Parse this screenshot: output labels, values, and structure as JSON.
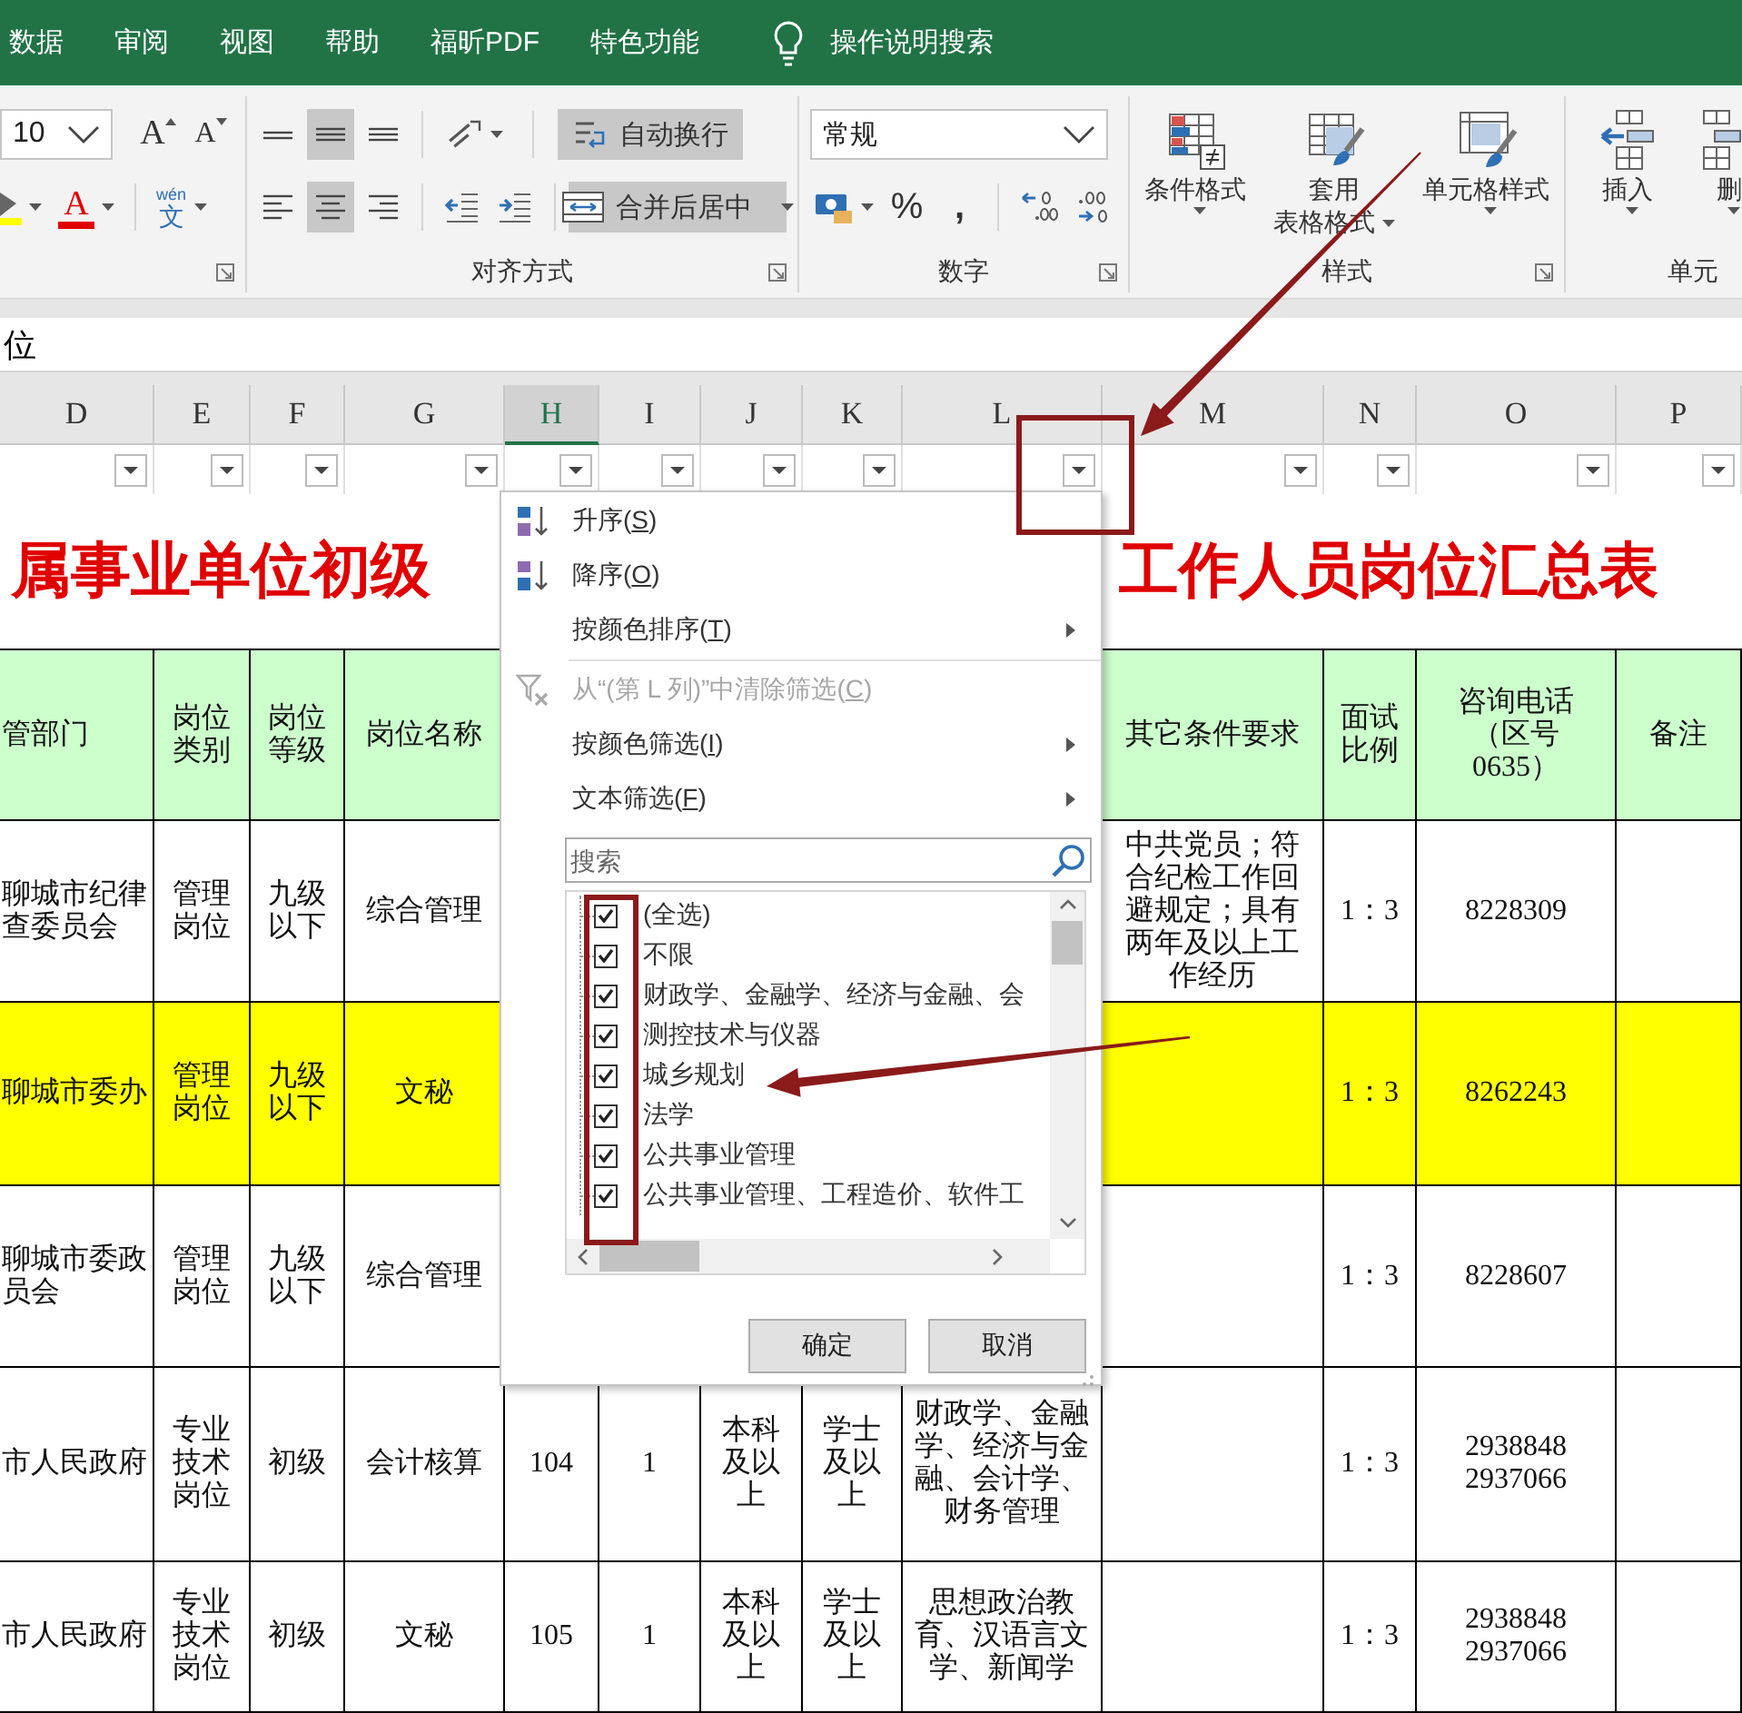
{
  "ribbon": {
    "tabs": [
      {
        "label": "数据",
        "selected": false
      },
      {
        "label": "审阅",
        "selected": false
      },
      {
        "label": "视图",
        "selected": false
      },
      {
        "label": "帮助",
        "selected": false
      },
      {
        "label": "福昕PDF",
        "selected": false
      },
      {
        "label": "特色功能",
        "selected": false
      }
    ],
    "tell_me": "操作说明搜索",
    "font": {
      "size": "10",
      "grow": "A",
      "shrink": "A",
      "fill_color": {
        "color": "#ffff00"
      },
      "font_color": {
        "glyph": "A",
        "color": "#e00000"
      },
      "phonetic": {
        "top": "wén",
        "glyph": "文"
      }
    },
    "alignment": {
      "label": "对齐方式",
      "vertical": [
        {
          "kind": "top",
          "selected": false
        },
        {
          "kind": "middle",
          "selected": true
        },
        {
          "kind": "bottom",
          "selected": false
        }
      ],
      "horizontal": [
        {
          "kind": "left",
          "selected": false
        },
        {
          "kind": "center",
          "selected": true
        },
        {
          "kind": "right",
          "selected": false
        }
      ],
      "wrap_text": {
        "label": "自动换行",
        "selected": true
      },
      "merge": {
        "label": "合并后居中",
        "selected": true
      }
    },
    "number": {
      "label": "数字",
      "format": "常规",
      "percent": "%",
      "comma": ","
    },
    "styles": {
      "label": "样式",
      "buttons": [
        {
          "kind": "conditional",
          "lines": [
            "条件格式"
          ]
        },
        {
          "kind": "table",
          "lines": [
            "套用",
            "表格格式"
          ]
        },
        {
          "kind": "cell",
          "lines": [
            "单元格样式"
          ]
        }
      ]
    },
    "cells": {
      "label": "单元",
      "buttons": [
        {
          "kind": "insert",
          "label": "插入"
        },
        {
          "kind": "delete",
          "label": "删"
        }
      ]
    }
  },
  "sheet": {
    "formula_bar": {
      "value": "位"
    },
    "columns": [
      {
        "letter": "D",
        "selected": false
      },
      {
        "letter": "E",
        "selected": false
      },
      {
        "letter": "F",
        "selected": false
      },
      {
        "letter": "G",
        "selected": false
      },
      {
        "letter": "H",
        "selected": true
      },
      {
        "letter": "I",
        "selected": false
      },
      {
        "letter": "J",
        "selected": false
      },
      {
        "letter": "K",
        "selected": false
      },
      {
        "letter": "L",
        "selected": false
      },
      {
        "letter": "M",
        "selected": false
      },
      {
        "letter": "N",
        "selected": false
      },
      {
        "letter": "O",
        "selected": false
      },
      {
        "letter": "P",
        "selected": false
      }
    ],
    "title": {
      "left": "属事业单位初级",
      "right": "工作人员岗位汇总表"
    },
    "header": {
      "D": "管部门",
      "E": "岗位类别",
      "F": "岗位等级",
      "G": "岗位名称",
      "M": "其它条件要求",
      "N": "面试比例",
      "O": "咨询电话（区号0635）",
      "P": "备注"
    },
    "rows": [
      {
        "highlighted": false,
        "cells": {
          "D": "聊城市纪律查委员会",
          "E": "管理岗位",
          "F": "九级以下",
          "G": "综合管理",
          "M": "中共党员；符合纪检工作回避规定；具有两年及以上工作经历",
          "N": "1：3",
          "O": "8228309"
        }
      },
      {
        "highlighted": true,
        "cells": {
          "D": "聊城市委办",
          "E": "管理岗位",
          "F": "九级以下",
          "G": "文秘",
          "N": "1：3",
          "O": "8262243"
        }
      },
      {
        "highlighted": false,
        "cells": {
          "D": "聊城市委政员会",
          "E": "管理岗位",
          "F": "九级以下",
          "G": "综合管理",
          "N": "1：3",
          "O": "8228607"
        }
      },
      {
        "highlighted": false,
        "cells": {
          "D": "市人民政府",
          "E": "专业技术岗位",
          "F": "初级",
          "G": "会计核算",
          "H": "104",
          "I": "1",
          "J": "本科及以上",
          "K": "学士及以上",
          "L": "财政学、金融学、经济与金融、会计学、财务管理",
          "N": "1：3",
          "O": "2938848\n2937066"
        }
      },
      {
        "highlighted": false,
        "cells": {
          "D": "市人民政府",
          "E": "专业技术岗位",
          "F": "初级",
          "G": "文秘",
          "H": "105",
          "I": "1",
          "J": "本科及以上",
          "K": "学士及以上",
          "L": "思想政治教育、汉语言文学、新闻学",
          "N": "1：3",
          "O": "2938848\n2937066"
        }
      }
    ]
  },
  "filter_menu": {
    "items": [
      {
        "kind": "sort_asc",
        "label": "升序(S)",
        "disabled": false,
        "submenu": false
      },
      {
        "kind": "sort_desc",
        "label": "降序(O)",
        "disabled": false,
        "submenu": false
      },
      {
        "kind": "sort_color",
        "label": "按颜色排序(T)",
        "disabled": false,
        "submenu": true
      },
      {
        "kind": "clear_filter",
        "label": "从“(第 L 列)”中清除筛选(C)",
        "disabled": true,
        "submenu": false
      },
      {
        "kind": "filter_color",
        "label": "按颜色筛选(I)",
        "disabled": false,
        "submenu": true
      },
      {
        "kind": "text_filter",
        "label": "文本筛选(F)",
        "disabled": false,
        "submenu": true
      }
    ],
    "search": {
      "placeholder": "搜索"
    },
    "values": [
      {
        "label": "(全选)",
        "checked": true
      },
      {
        "label": "不限",
        "checked": true
      },
      {
        "label": "财政学、金融学、经济与金融、会",
        "checked": true
      },
      {
        "label": "测控技术与仪器",
        "checked": true
      },
      {
        "label": "城乡规划",
        "checked": true
      },
      {
        "label": "法学",
        "checked": true
      },
      {
        "label": "公共事业管理",
        "checked": true
      },
      {
        "label": "公共事业管理、工程造价、软件工",
        "checked": true
      }
    ],
    "buttons": [
      "确定",
      "取消"
    ]
  }
}
